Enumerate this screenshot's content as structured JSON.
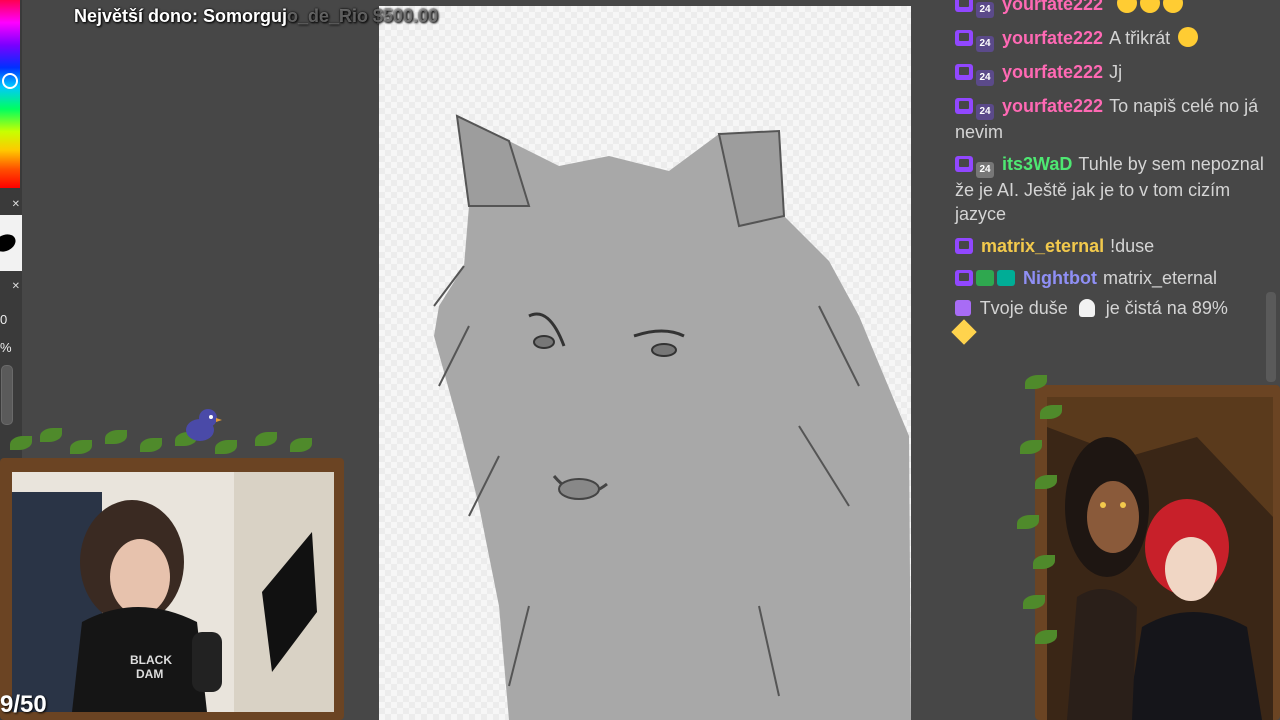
{
  "overlay": {
    "top_donation_label": "Největší dono: Somorguj",
    "top_donation_faint": "o_de_Rio $500.00",
    "counter": "9/50"
  },
  "tool_panel": {
    "value_top": "0",
    "value_percent": "%"
  },
  "canvas": {
    "subject_icon": "wolf-sketch"
  },
  "chat": {
    "messages": [
      {
        "user": "yourfate222",
        "user_color": "#ff69b4",
        "text": "",
        "badges": [
          "twitch",
          "month-24"
        ],
        "emotes": [
          "grinning",
          "grinning",
          "grinning"
        ]
      },
      {
        "user": "yourfate222",
        "user_color": "#ff69b4",
        "text": "A třikrát",
        "badges": [
          "twitch",
          "month-24"
        ],
        "emotes": [
          "rofl"
        ]
      },
      {
        "user": "yourfate222",
        "user_color": "#ff69b4",
        "text": "Jj",
        "badges": [
          "twitch",
          "month-24"
        ]
      },
      {
        "user": "yourfate222",
        "user_color": "#ff69b4",
        "text": "To napiš celé no já nevim",
        "badges": [
          "twitch",
          "month-24"
        ]
      },
      {
        "user": "its3WaD",
        "user_color": "#4ee872",
        "text": "Tuhle by sem nepoznal že je AI. Ještě jak je to v tom cizím jazyce",
        "badges": [
          "twitch",
          "month-gray"
        ]
      },
      {
        "user": "matrix_eternal",
        "user_color": "#f2c94c",
        "text": "!duse",
        "badges": [
          "twitch"
        ]
      },
      {
        "user": "Nightbot",
        "user_color": "#8f8ff5",
        "text": "matrix_eternal",
        "badges": [
          "twitch",
          "verified",
          "mod"
        ]
      },
      {
        "user": "",
        "user_color": "#d4d4d4",
        "text": "Tvoje duše",
        "text2": "je čistá na 89%",
        "badges": []
      }
    ]
  },
  "colors": {
    "background": "#474747",
    "chat_text": "#d4d4d4",
    "twitch_purple": "#9147ff",
    "frame_wood": "#6b4423"
  }
}
